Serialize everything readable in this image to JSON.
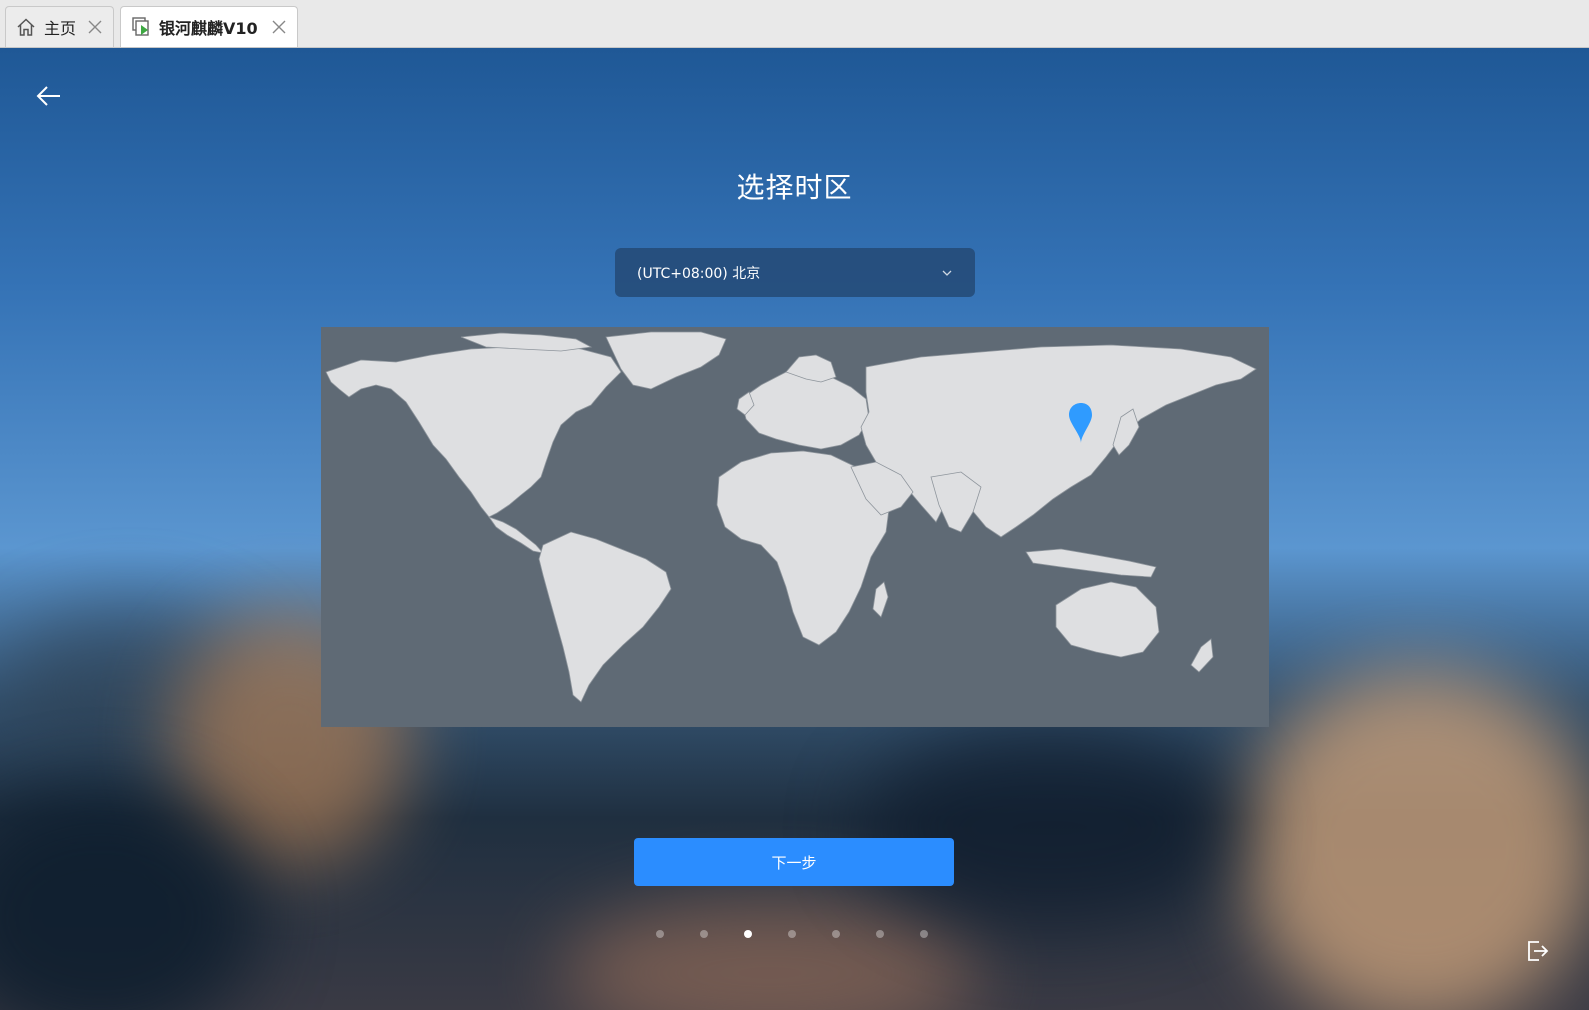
{
  "tabs": [
    {
      "label": "主页",
      "icon": "home-icon",
      "active": false
    },
    {
      "label": "银河麒麟V10",
      "icon": "vm-icon",
      "active": true
    }
  ],
  "page": {
    "title": "选择时区",
    "timezone_value": "(UTC+08:00) 北京",
    "next_label": "下一步",
    "steps_total": 7,
    "steps_current": 3
  },
  "colors": {
    "accent": "#2b8dff",
    "map_ocean": "#5f6a75",
    "map_land": "#dedfe1",
    "marker": "#2f9bff"
  }
}
